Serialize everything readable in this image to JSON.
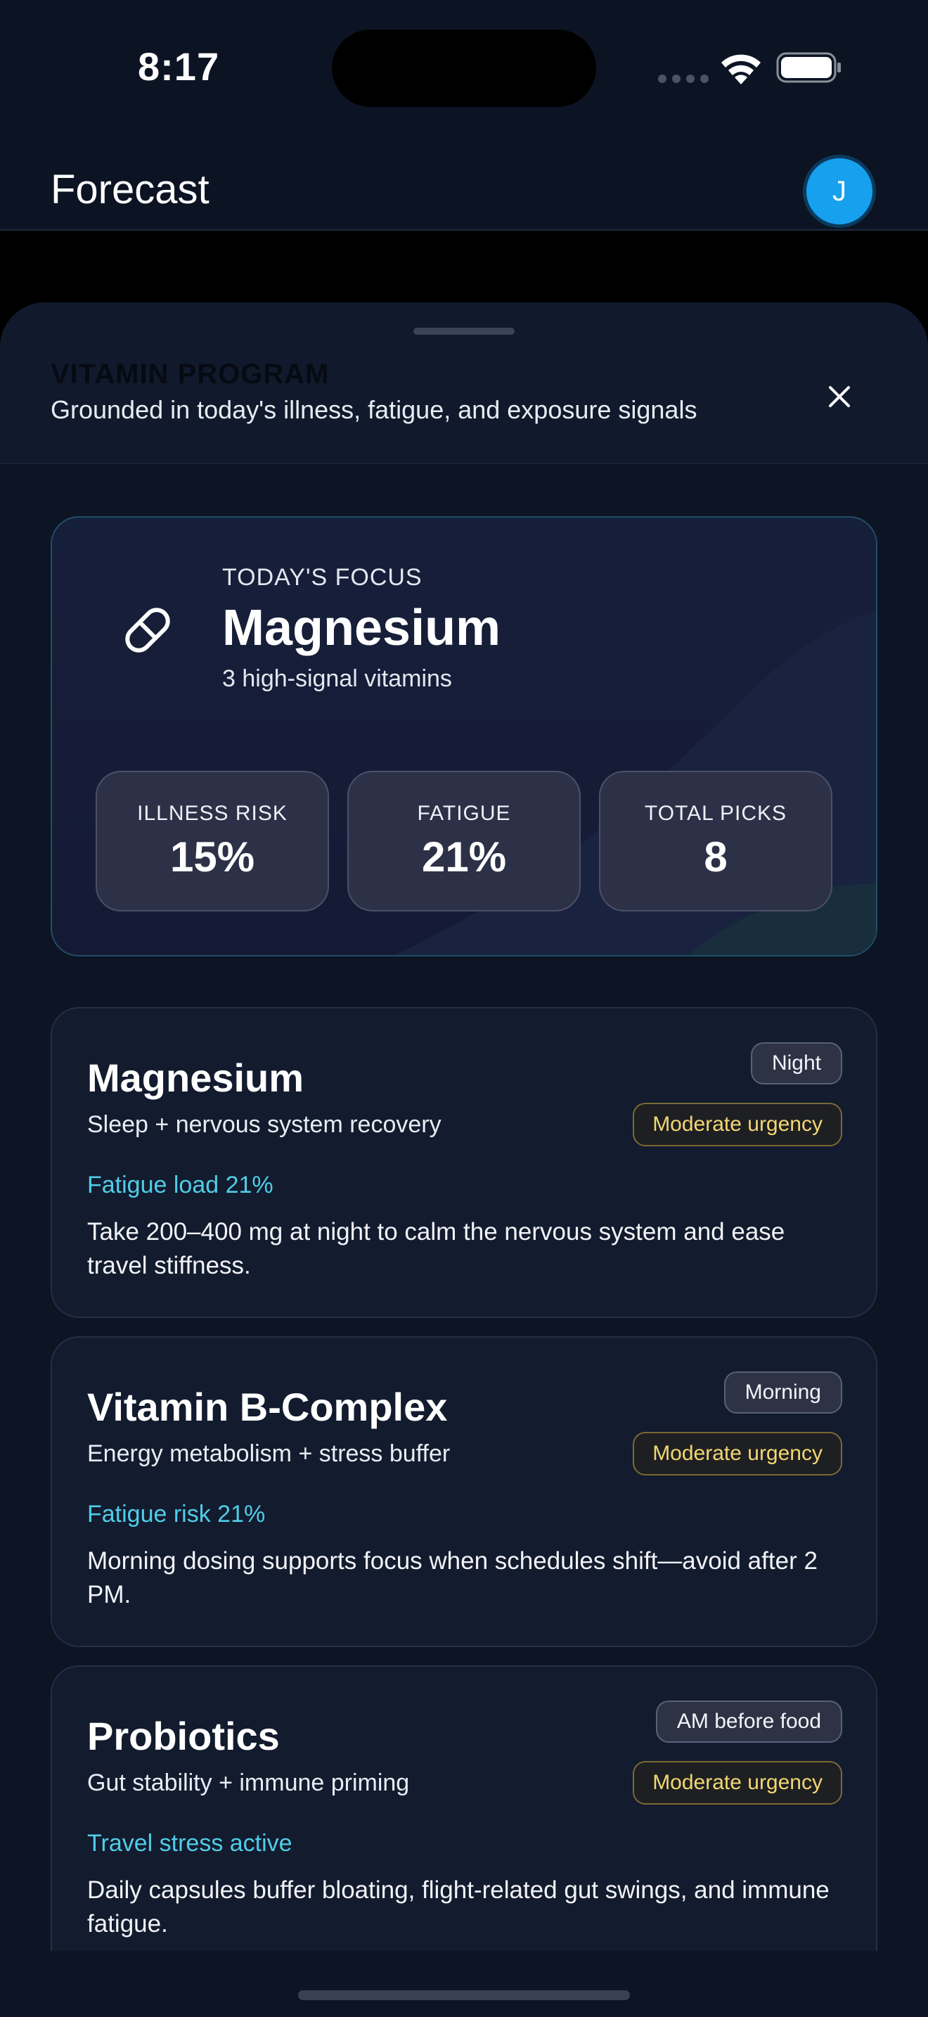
{
  "status_bar": {
    "time": "8:17"
  },
  "app_header": {
    "title": "Forecast",
    "avatar_initial": "J"
  },
  "sheet": {
    "eyebrow": "VITAMIN PROGRAM",
    "subtitle": "Grounded in today's illness, fatigue, and exposure signals"
  },
  "focus": {
    "eyebrow": "TODAY'S FOCUS",
    "title": "Magnesium",
    "subtitle": "3 high-signal vitamins",
    "stats": [
      {
        "label": "ILLNESS RISK",
        "value": "15%"
      },
      {
        "label": "FATIGUE",
        "value": "21%"
      },
      {
        "label": "TOTAL PICKS",
        "value": "8"
      }
    ]
  },
  "recommendations": [
    {
      "title": "Magnesium",
      "subtitle": "Sleep + nervous system recovery",
      "timing": "Night",
      "urgency": "Moderate urgency",
      "metric": "Fatigue load 21%",
      "body": "Take 200–400 mg at night to calm the nervous system and ease travel stiffness."
    },
    {
      "title": "Vitamin B-Complex",
      "subtitle": "Energy metabolism + stress buffer",
      "timing": "Morning",
      "urgency": "Moderate urgency",
      "metric": "Fatigue risk 21%",
      "body": "Morning dosing supports focus when schedules shift—avoid after 2 PM."
    },
    {
      "title": "Probiotics",
      "subtitle": "Gut stability + immune priming",
      "timing": "AM before food",
      "urgency": "Moderate urgency",
      "metric": "Travel stress active",
      "body": "Daily capsules buffer bloating, flight-related gut swings, and immune fatigue."
    }
  ],
  "colors": {
    "accent_metric": "#50cde8",
    "urgency": "#f2d771",
    "avatar": "#17a0ee",
    "sheet_bg": "#0d1424"
  },
  "icons": {
    "close": "close-icon",
    "focus": "pill-icon",
    "wifi": "wifi-icon",
    "battery": "battery-icon"
  }
}
